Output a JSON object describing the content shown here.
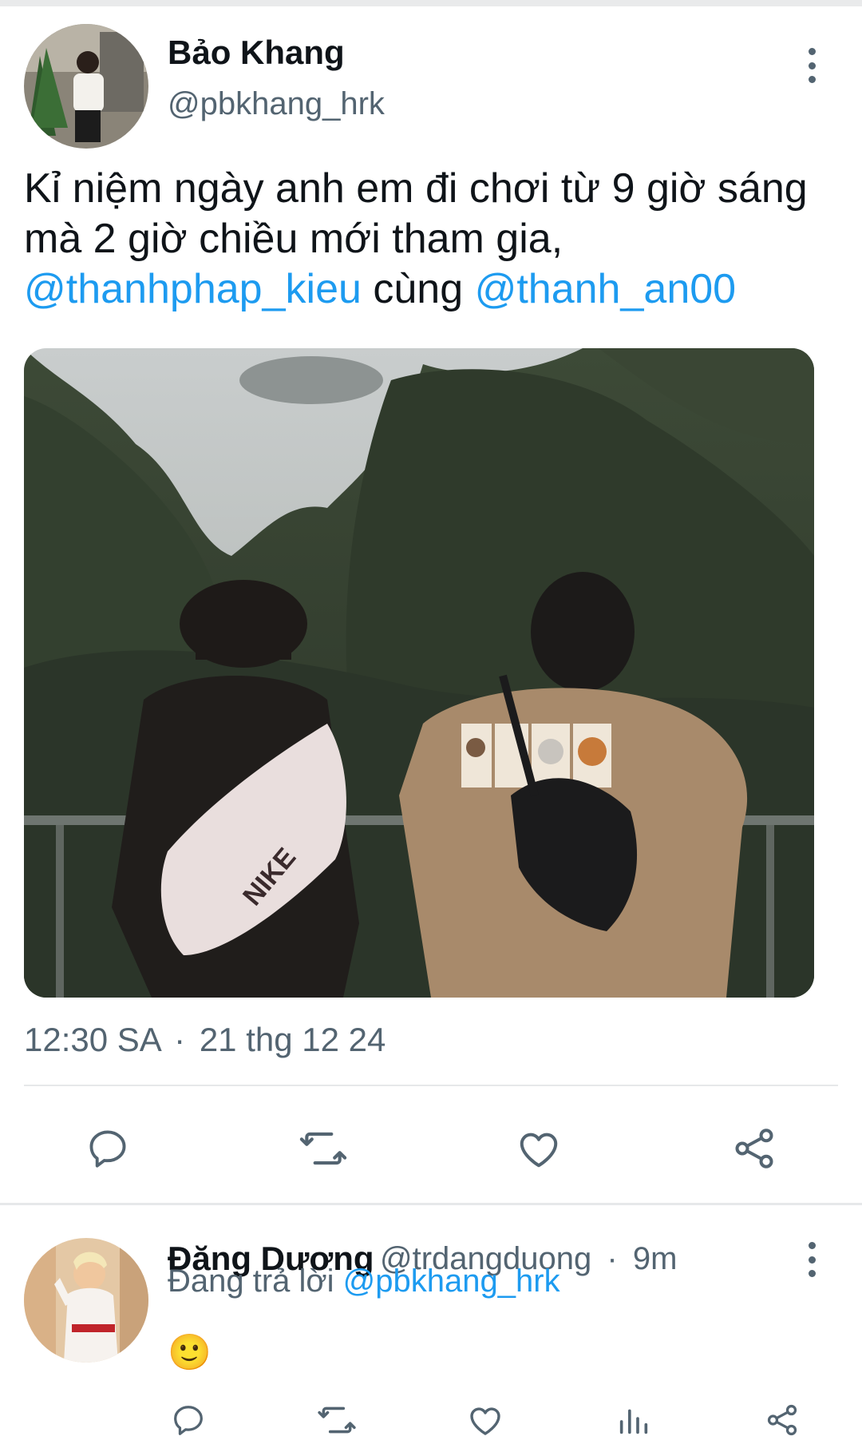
{
  "tweet": {
    "author_name": "Bảo Khang",
    "author_handle": "@pbkhang_hrk",
    "text_before": "Kỉ niệm ngày anh em đi chơi từ 9 giờ sáng mà 2 giờ chiều mới tham gia, ",
    "mention_1": "@thanhphap_kieu",
    "text_middle": " cùng ",
    "mention_2": "@thanh_an00",
    "time": "12:30 SA",
    "separator": "·",
    "date": "21 thg 12 24",
    "image_alt": "photo"
  },
  "actions": {
    "icons": [
      "reply-icon",
      "retweet-icon",
      "like-icon",
      "share-icon"
    ]
  },
  "reply": {
    "author_name": "Đăng Dương",
    "author_handle": "@trdangduong",
    "separator": "·",
    "age": "9m",
    "replying_label": "Đang trả lời",
    "replying_to": "@pbkhang_hrk",
    "content": "🙂",
    "icons": [
      "reply-icon",
      "retweet-icon",
      "like-icon",
      "analytics-icon",
      "share-icon"
    ]
  },
  "colors": {
    "accent": "#1d9bf0",
    "secondary_text": "#536471",
    "primary_text": "#0f1419",
    "divider": "#e6e8ea"
  }
}
